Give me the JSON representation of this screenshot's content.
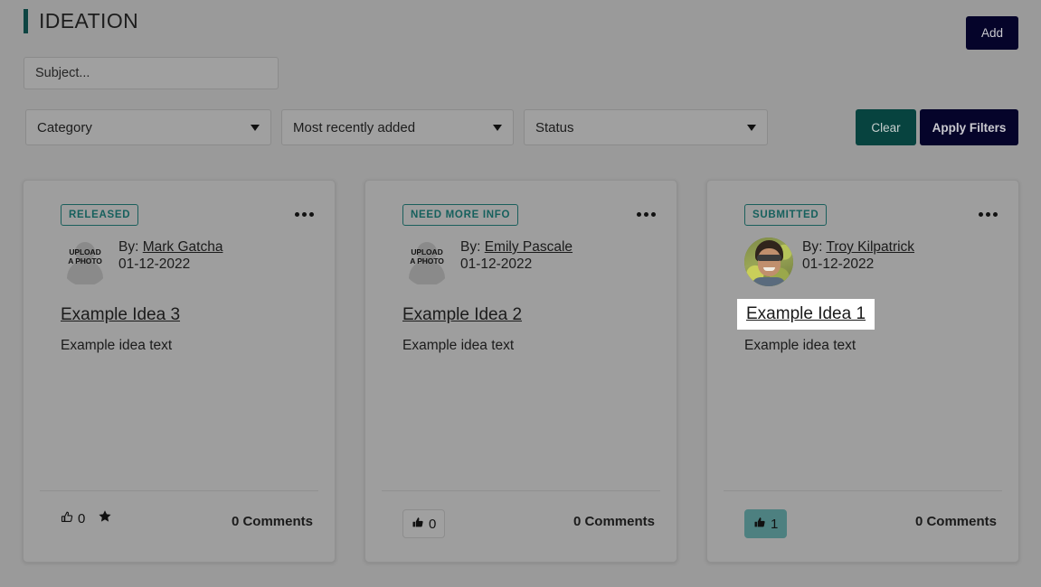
{
  "header": {
    "title": "IDEATION",
    "add_label": "Add",
    "accent_color": "#0d4442",
    "button_color": "#05042a"
  },
  "search": {
    "placeholder": "Subject...",
    "value": ""
  },
  "filters": {
    "category": {
      "label": "Category",
      "icon": "chevron-down-icon"
    },
    "sort": {
      "label": "Most recently added",
      "icon": "chevron-down-icon"
    },
    "status": {
      "label": "Status",
      "icon": "chevron-down-icon"
    },
    "clear_label": "Clear",
    "apply_label": "Apply Filters",
    "clear_color": "#07433f",
    "apply_color": "#05042a"
  },
  "cards": [
    {
      "status": "RELEASED",
      "menu_icon": "ellipsis-icon",
      "avatar_type": "upload-placeholder",
      "avatar_text_line1": "UPLOAD",
      "avatar_text_line2": "A PHOTO",
      "by_prefix": "By:",
      "author": "Mark Gatcha",
      "date": "01-12-2022",
      "title": "Example Idea 3",
      "body": "Example idea text",
      "like_count": "0",
      "like_style": "plain",
      "like_icon": "thumbs-up-outline-icon",
      "has_star": true,
      "star_icon": "star-filled-icon",
      "comments": "0 Comments",
      "focused": false
    },
    {
      "status": "NEED MORE INFO",
      "menu_icon": "ellipsis-icon",
      "avatar_type": "upload-placeholder",
      "avatar_text_line1": "UPLOAD",
      "avatar_text_line2": "A PHOTO",
      "by_prefix": "By:",
      "author": "Emily Pascale",
      "date": "01-12-2022",
      "title": "Example Idea 2",
      "body": "Example idea text",
      "like_count": "0",
      "like_style": "boxed",
      "like_icon": "thumbs-up-filled-icon",
      "has_star": false,
      "star_icon": "",
      "comments": "0 Comments",
      "focused": false
    },
    {
      "status": "SUBMITTED",
      "menu_icon": "ellipsis-icon",
      "avatar_type": "photo",
      "avatar_text_line1": "",
      "avatar_text_line2": "",
      "by_prefix": "By:",
      "author": "Troy Kilpatrick",
      "date": "01-12-2022",
      "title": "Example Idea 1",
      "body": "Example idea text",
      "like_count": "1",
      "like_style": "active",
      "like_icon": "thumbs-up-filled-icon",
      "has_star": false,
      "star_icon": "",
      "comments": "0 Comments",
      "focused": true
    }
  ],
  "colors": {
    "page_background": "#9a9a9a",
    "card_background": "#9e9e9e",
    "badge_teal": "#16605d",
    "like_active_teal": "#4d8080"
  }
}
